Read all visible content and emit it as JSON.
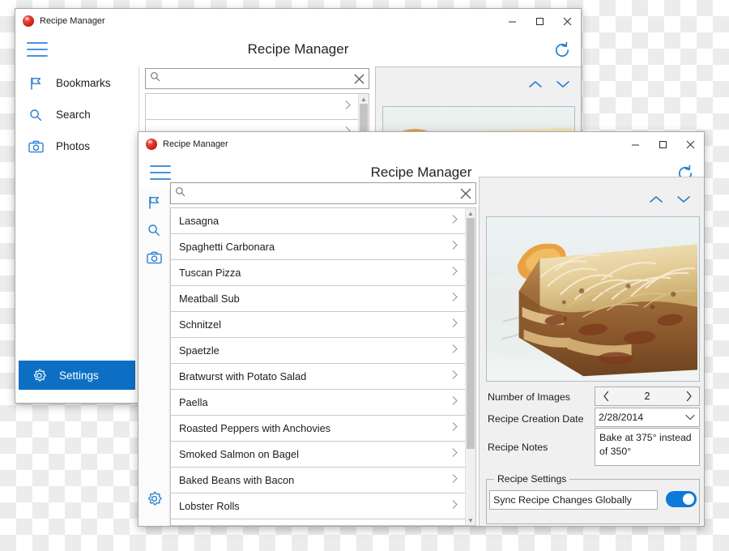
{
  "background": {
    "checker_light": "#ffffff",
    "checker_dark": "#ececec"
  },
  "accent_color": "#0d6fc4",
  "back_window": {
    "titlebar": {
      "app_name": "Recipe Manager",
      "app_icon": "recipe-app-icon",
      "minimize": "minimize-icon",
      "maximize": "maximize-icon",
      "close": "close-icon"
    },
    "appbar": {
      "menu_icon": "hamburger-icon",
      "title": "Recipe Manager",
      "refresh_icon": "refresh-icon"
    },
    "sidebar": {
      "items": [
        {
          "label": "Bookmarks",
          "icon": "flag-icon",
          "selected": false
        },
        {
          "label": "Search",
          "icon": "search-icon",
          "selected": false
        },
        {
          "label": "Photos",
          "icon": "camera-icon",
          "selected": false
        }
      ],
      "footer": {
        "label": "Settings",
        "icon": "gear-icon",
        "selected": true
      }
    },
    "search": {
      "value": "",
      "placeholder": "",
      "clear_icon": "close-icon"
    },
    "list": {
      "rows": [
        "",
        "",
        ""
      ]
    },
    "detail": {
      "prev_icon": "chevron-up-icon",
      "next_icon": "chevron-down-icon",
      "photo_alt": "lasagna-photo"
    }
  },
  "front_window": {
    "titlebar": {
      "app_name": "Recipe Manager",
      "app_icon": "recipe-app-icon",
      "minimize": "minimize-icon",
      "maximize": "maximize-icon",
      "close": "close-icon"
    },
    "appbar": {
      "menu_icon": "hamburger-icon",
      "title": "Recipe Manager",
      "refresh_icon": "refresh-icon"
    },
    "rail": {
      "items": [
        {
          "icon": "flag-icon",
          "name": "bookmarks"
        },
        {
          "icon": "search-icon",
          "name": "search"
        },
        {
          "icon": "camera-icon",
          "name": "photos"
        }
      ],
      "footer": {
        "icon": "gear-icon",
        "name": "settings"
      }
    },
    "search": {
      "value": "",
      "placeholder": "",
      "clear_icon": "close-icon",
      "search_icon": "search-icon"
    },
    "list": {
      "rows": [
        "Lasagna",
        "Spaghetti Carbonara",
        "Tuscan Pizza",
        "Meatball Sub",
        "Schnitzel",
        "Spaetzle",
        "Bratwurst with Potato Salad",
        "Paella",
        "Roasted Peppers with Anchovies",
        "Smoked Salmon on Bagel",
        "Baked Beans with Bacon",
        "Lobster Rolls"
      ],
      "row_chevron_icon": "chevron-right-icon",
      "scroll_up_icon": "scroll-up-arrow",
      "scroll_down_icon": "scroll-down-arrow"
    },
    "detail": {
      "prev_icon": "chevron-up-icon",
      "next_icon": "chevron-down-icon",
      "photo_alt": "lasagna-photo",
      "fields": {
        "images_label": "Number of Images",
        "images_value": "2",
        "images_prev_icon": "chevron-left-icon",
        "images_next_icon": "chevron-right-icon",
        "date_label": "Recipe Creation Date",
        "date_value": "2/28/2014",
        "date_dropdown_icon": "chevron-down-icon",
        "notes_label": "Recipe Notes",
        "notes_value": "Bake at 375° instead of 350°"
      },
      "settings_group": {
        "title": "Recipe Settings",
        "sync_label": "Sync Recipe Changes Globally",
        "sync_enabled": true
      }
    }
  }
}
